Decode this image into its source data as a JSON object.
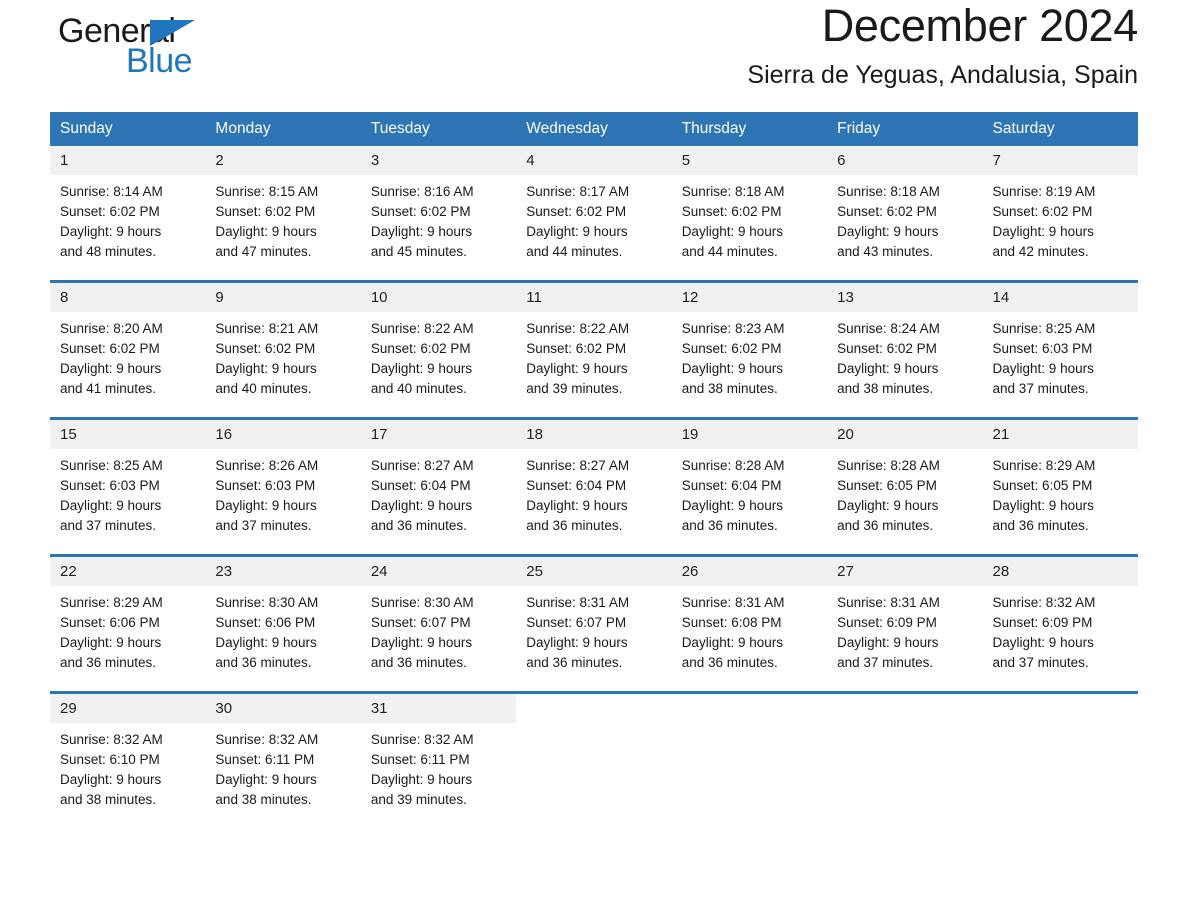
{
  "brand": {
    "name_part1": "General",
    "name_part2": "Blue"
  },
  "header": {
    "month_title": "December 2024",
    "location": "Sierra de Yeguas, Andalusia, Spain"
  },
  "colors": {
    "header_blue": "#2e75b6",
    "logo_blue": "#1f76bc",
    "daynum_band": "#f1f1f1",
    "text": "#1a1a1a"
  },
  "weekday_headers": [
    "Sunday",
    "Monday",
    "Tuesday",
    "Wednesday",
    "Thursday",
    "Friday",
    "Saturday"
  ],
  "weeks": [
    [
      {
        "day": "1",
        "sunrise": "Sunrise: 8:14 AM",
        "sunset": "Sunset: 6:02 PM",
        "daylight_line1": "Daylight: 9 hours",
        "daylight_line2": "and 48 minutes."
      },
      {
        "day": "2",
        "sunrise": "Sunrise: 8:15 AM",
        "sunset": "Sunset: 6:02 PM",
        "daylight_line1": "Daylight: 9 hours",
        "daylight_line2": "and 47 minutes."
      },
      {
        "day": "3",
        "sunrise": "Sunrise: 8:16 AM",
        "sunset": "Sunset: 6:02 PM",
        "daylight_line1": "Daylight: 9 hours",
        "daylight_line2": "and 45 minutes."
      },
      {
        "day": "4",
        "sunrise": "Sunrise: 8:17 AM",
        "sunset": "Sunset: 6:02 PM",
        "daylight_line1": "Daylight: 9 hours",
        "daylight_line2": "and 44 minutes."
      },
      {
        "day": "5",
        "sunrise": "Sunrise: 8:18 AM",
        "sunset": "Sunset: 6:02 PM",
        "daylight_line1": "Daylight: 9 hours",
        "daylight_line2": "and 44 minutes."
      },
      {
        "day": "6",
        "sunrise": "Sunrise: 8:18 AM",
        "sunset": "Sunset: 6:02 PM",
        "daylight_line1": "Daylight: 9 hours",
        "daylight_line2": "and 43 minutes."
      },
      {
        "day": "7",
        "sunrise": "Sunrise: 8:19 AM",
        "sunset": "Sunset: 6:02 PM",
        "daylight_line1": "Daylight: 9 hours",
        "daylight_line2": "and 42 minutes."
      }
    ],
    [
      {
        "day": "8",
        "sunrise": "Sunrise: 8:20 AM",
        "sunset": "Sunset: 6:02 PM",
        "daylight_line1": "Daylight: 9 hours",
        "daylight_line2": "and 41 minutes."
      },
      {
        "day": "9",
        "sunrise": "Sunrise: 8:21 AM",
        "sunset": "Sunset: 6:02 PM",
        "daylight_line1": "Daylight: 9 hours",
        "daylight_line2": "and 40 minutes."
      },
      {
        "day": "10",
        "sunrise": "Sunrise: 8:22 AM",
        "sunset": "Sunset: 6:02 PM",
        "daylight_line1": "Daylight: 9 hours",
        "daylight_line2": "and 40 minutes."
      },
      {
        "day": "11",
        "sunrise": "Sunrise: 8:22 AM",
        "sunset": "Sunset: 6:02 PM",
        "daylight_line1": "Daylight: 9 hours",
        "daylight_line2": "and 39 minutes."
      },
      {
        "day": "12",
        "sunrise": "Sunrise: 8:23 AM",
        "sunset": "Sunset: 6:02 PM",
        "daylight_line1": "Daylight: 9 hours",
        "daylight_line2": "and 38 minutes."
      },
      {
        "day": "13",
        "sunrise": "Sunrise: 8:24 AM",
        "sunset": "Sunset: 6:02 PM",
        "daylight_line1": "Daylight: 9 hours",
        "daylight_line2": "and 38 minutes."
      },
      {
        "day": "14",
        "sunrise": "Sunrise: 8:25 AM",
        "sunset": "Sunset: 6:03 PM",
        "daylight_line1": "Daylight: 9 hours",
        "daylight_line2": "and 37 minutes."
      }
    ],
    [
      {
        "day": "15",
        "sunrise": "Sunrise: 8:25 AM",
        "sunset": "Sunset: 6:03 PM",
        "daylight_line1": "Daylight: 9 hours",
        "daylight_line2": "and 37 minutes."
      },
      {
        "day": "16",
        "sunrise": "Sunrise: 8:26 AM",
        "sunset": "Sunset: 6:03 PM",
        "daylight_line1": "Daylight: 9 hours",
        "daylight_line2": "and 37 minutes."
      },
      {
        "day": "17",
        "sunrise": "Sunrise: 8:27 AM",
        "sunset": "Sunset: 6:04 PM",
        "daylight_line1": "Daylight: 9 hours",
        "daylight_line2": "and 36 minutes."
      },
      {
        "day": "18",
        "sunrise": "Sunrise: 8:27 AM",
        "sunset": "Sunset: 6:04 PM",
        "daylight_line1": "Daylight: 9 hours",
        "daylight_line2": "and 36 minutes."
      },
      {
        "day": "19",
        "sunrise": "Sunrise: 8:28 AM",
        "sunset": "Sunset: 6:04 PM",
        "daylight_line1": "Daylight: 9 hours",
        "daylight_line2": "and 36 minutes."
      },
      {
        "day": "20",
        "sunrise": "Sunrise: 8:28 AM",
        "sunset": "Sunset: 6:05 PM",
        "daylight_line1": "Daylight: 9 hours",
        "daylight_line2": "and 36 minutes."
      },
      {
        "day": "21",
        "sunrise": "Sunrise: 8:29 AM",
        "sunset": "Sunset: 6:05 PM",
        "daylight_line1": "Daylight: 9 hours",
        "daylight_line2": "and 36 minutes."
      }
    ],
    [
      {
        "day": "22",
        "sunrise": "Sunrise: 8:29 AM",
        "sunset": "Sunset: 6:06 PM",
        "daylight_line1": "Daylight: 9 hours",
        "daylight_line2": "and 36 minutes."
      },
      {
        "day": "23",
        "sunrise": "Sunrise: 8:30 AM",
        "sunset": "Sunset: 6:06 PM",
        "daylight_line1": "Daylight: 9 hours",
        "daylight_line2": "and 36 minutes."
      },
      {
        "day": "24",
        "sunrise": "Sunrise: 8:30 AM",
        "sunset": "Sunset: 6:07 PM",
        "daylight_line1": "Daylight: 9 hours",
        "daylight_line2": "and 36 minutes."
      },
      {
        "day": "25",
        "sunrise": "Sunrise: 8:31 AM",
        "sunset": "Sunset: 6:07 PM",
        "daylight_line1": "Daylight: 9 hours",
        "daylight_line2": "and 36 minutes."
      },
      {
        "day": "26",
        "sunrise": "Sunrise: 8:31 AM",
        "sunset": "Sunset: 6:08 PM",
        "daylight_line1": "Daylight: 9 hours",
        "daylight_line2": "and 36 minutes."
      },
      {
        "day": "27",
        "sunrise": "Sunrise: 8:31 AM",
        "sunset": "Sunset: 6:09 PM",
        "daylight_line1": "Daylight: 9 hours",
        "daylight_line2": "and 37 minutes."
      },
      {
        "day": "28",
        "sunrise": "Sunrise: 8:32 AM",
        "sunset": "Sunset: 6:09 PM",
        "daylight_line1": "Daylight: 9 hours",
        "daylight_line2": "and 37 minutes."
      }
    ],
    [
      {
        "day": "29",
        "sunrise": "Sunrise: 8:32 AM",
        "sunset": "Sunset: 6:10 PM",
        "daylight_line1": "Daylight: 9 hours",
        "daylight_line2": "and 38 minutes."
      },
      {
        "day": "30",
        "sunrise": "Sunrise: 8:32 AM",
        "sunset": "Sunset: 6:11 PM",
        "daylight_line1": "Daylight: 9 hours",
        "daylight_line2": "and 38 minutes."
      },
      {
        "day": "31",
        "sunrise": "Sunrise: 8:32 AM",
        "sunset": "Sunset: 6:11 PM",
        "daylight_line1": "Daylight: 9 hours",
        "daylight_line2": "and 39 minutes."
      },
      {
        "day": "",
        "sunrise": "",
        "sunset": "",
        "daylight_line1": "",
        "daylight_line2": ""
      },
      {
        "day": "",
        "sunrise": "",
        "sunset": "",
        "daylight_line1": "",
        "daylight_line2": ""
      },
      {
        "day": "",
        "sunrise": "",
        "sunset": "",
        "daylight_line1": "",
        "daylight_line2": ""
      },
      {
        "day": "",
        "sunrise": "",
        "sunset": "",
        "daylight_line1": "",
        "daylight_line2": ""
      }
    ]
  ]
}
